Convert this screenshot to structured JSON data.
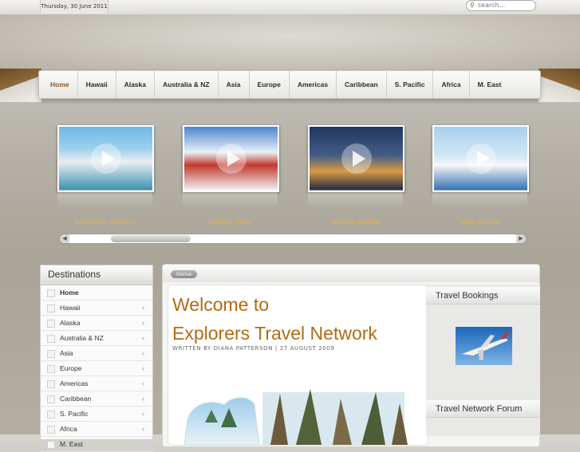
{
  "top": {
    "date": "Thursday, 30 June 2011",
    "search_placeholder": "search..."
  },
  "nav": {
    "items": [
      "Home",
      "Hawaii",
      "Alaska",
      "Australia & NZ",
      "Asia",
      "Europe",
      "Americas",
      "Caribbean",
      "S. Pacific",
      "Africa",
      "M. East"
    ],
    "active": "Home"
  },
  "showcase": {
    "items": [
      {
        "caption": "Sail/Power Charters",
        "icon": "play-icon"
      },
      {
        "caption": "Railway Tours",
        "icon": "play-icon"
      },
      {
        "caption": "Vacation Rentals",
        "icon": "play-icon"
      },
      {
        "caption": "Study Abroad",
        "icon": "play-icon"
      }
    ],
    "caption_color": "#e3b24d"
  },
  "sidebar": {
    "title": "Destinations",
    "items": [
      "Home",
      "Hawaii",
      "Alaska",
      "Australia & NZ",
      "Asia",
      "Europe",
      "Americas",
      "Caribbean",
      "S. Pacific",
      "Africa",
      "M. East"
    ]
  },
  "breadcrumb": {
    "label": "Home"
  },
  "article": {
    "title_line1": "Welcome to",
    "title_line2": "Explorers Travel Network",
    "byline": "WRITTEN BY DIANA PATTERSON | 27 AUGUST 2009",
    "title_color": "#b46a12"
  },
  "modules": {
    "bookings_title": "Travel Bookings",
    "forum_title": "Travel Network Forum"
  }
}
